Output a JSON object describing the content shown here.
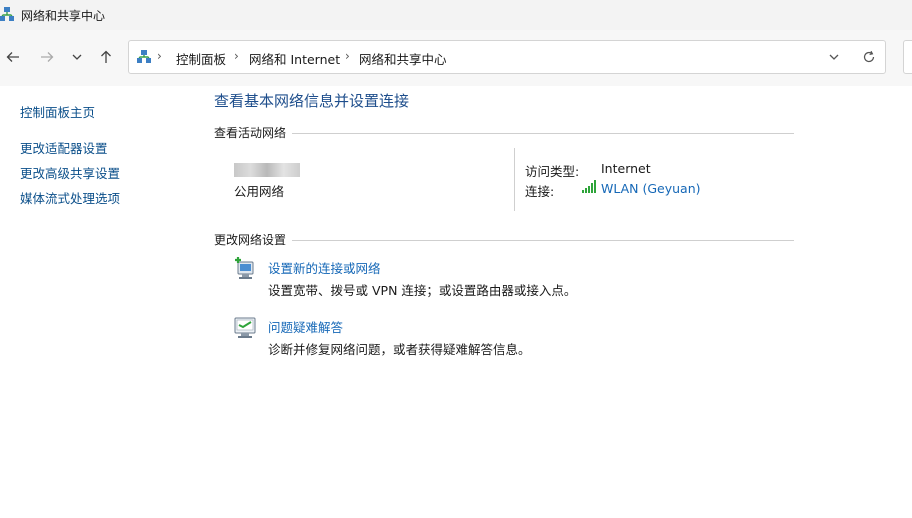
{
  "window": {
    "title": "网络和共享中心"
  },
  "breadcrumb": {
    "items": [
      "控制面板",
      "网络和 Internet",
      "网络和共享中心"
    ],
    "separator": "›"
  },
  "sidebar": {
    "items": [
      {
        "label": "控制面板主页"
      },
      {
        "label": "更改适配器设置"
      },
      {
        "label": "更改高级共享设置"
      },
      {
        "label": "媒体流式处理选项"
      }
    ]
  },
  "main": {
    "title": "查看基本网络信息并设置连接",
    "active_section": "查看活动网络",
    "network": {
      "type_label": "公用网络",
      "access_label": "访问类型:",
      "access_value": "Internet",
      "connection_label": "连接:",
      "connection_value": "WLAN (Geyuan)"
    },
    "change_section": "更改网络设置",
    "tasks": [
      {
        "title": "设置新的连接或网络",
        "desc": "设置宽带、拨号或 VPN 连接；或设置路由器或接入点。",
        "icon": "new-connection-icon"
      },
      {
        "title": "问题疑难解答",
        "desc": "诊断并修复网络问题，或者获得疑难解答信息。",
        "icon": "troubleshoot-icon"
      }
    ]
  },
  "colors": {
    "link": "#1668b7",
    "title": "#1e4e8c",
    "wifi": "#2ea43a"
  }
}
